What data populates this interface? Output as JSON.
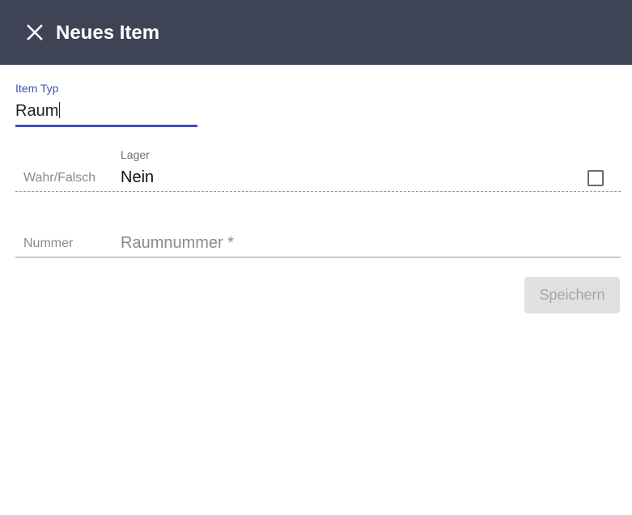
{
  "header": {
    "title": "Neues Item",
    "close_icon": "close-icon",
    "background": "#3e4455"
  },
  "item_type": {
    "label": "Item Typ",
    "value": "Raum",
    "accent": "#3f51b5"
  },
  "lager": {
    "row_label": "Wahr/Falsch",
    "label": "Lager",
    "value": "Nein",
    "checked": false
  },
  "nummer": {
    "row_label": "Nummer",
    "placeholder": "Raumnummer *",
    "value": ""
  },
  "actions": {
    "save_label": "Speichern",
    "save_disabled": true
  }
}
